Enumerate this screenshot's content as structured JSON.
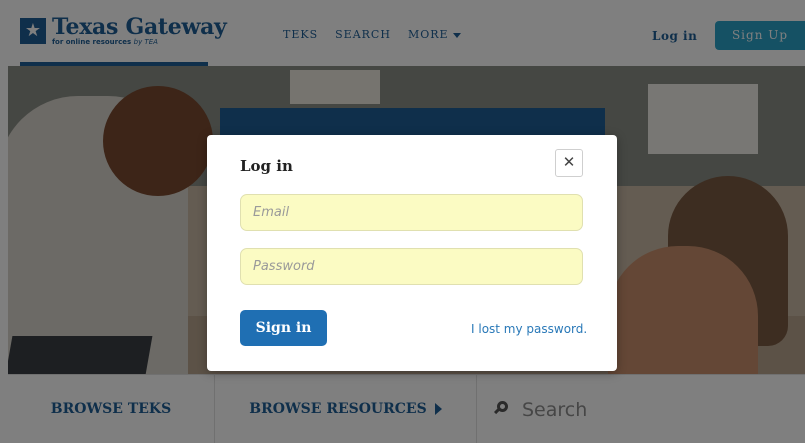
{
  "header": {
    "logo_title": "Texas Gateway",
    "logo_subtitle_main": "for online resources",
    "logo_subtitle_by": "by TEA",
    "logo_star": "★",
    "nav": [
      {
        "label": "TEKS"
      },
      {
        "label": "SEARCH"
      },
      {
        "label": "MORE"
      }
    ],
    "login_label": "Log in",
    "signup_label": "Sign Up"
  },
  "bottom_bar": {
    "browse_teks": "BROWSE TEKS",
    "browse_resources": "BROWSE RESOURCES",
    "search_placeholder": "Search"
  },
  "modal": {
    "title": "Log in",
    "close_glyph": "✕",
    "email_placeholder": "Email",
    "email_value": "",
    "password_placeholder": "Password",
    "password_value": "",
    "signin_label": "Sign in",
    "lost_password_label": "I lost my password."
  },
  "colors": {
    "brand_blue": "#1f5f97",
    "signup_teal": "#2aa3c9",
    "signin_blue": "#1f6fb3",
    "field_yellow": "#fbfbc3"
  },
  "icons": {
    "logo": "star-icon",
    "nav_more": "caret-down-icon",
    "browse_resources": "triangle-right-icon",
    "search": "search-icon",
    "close": "close-icon"
  }
}
